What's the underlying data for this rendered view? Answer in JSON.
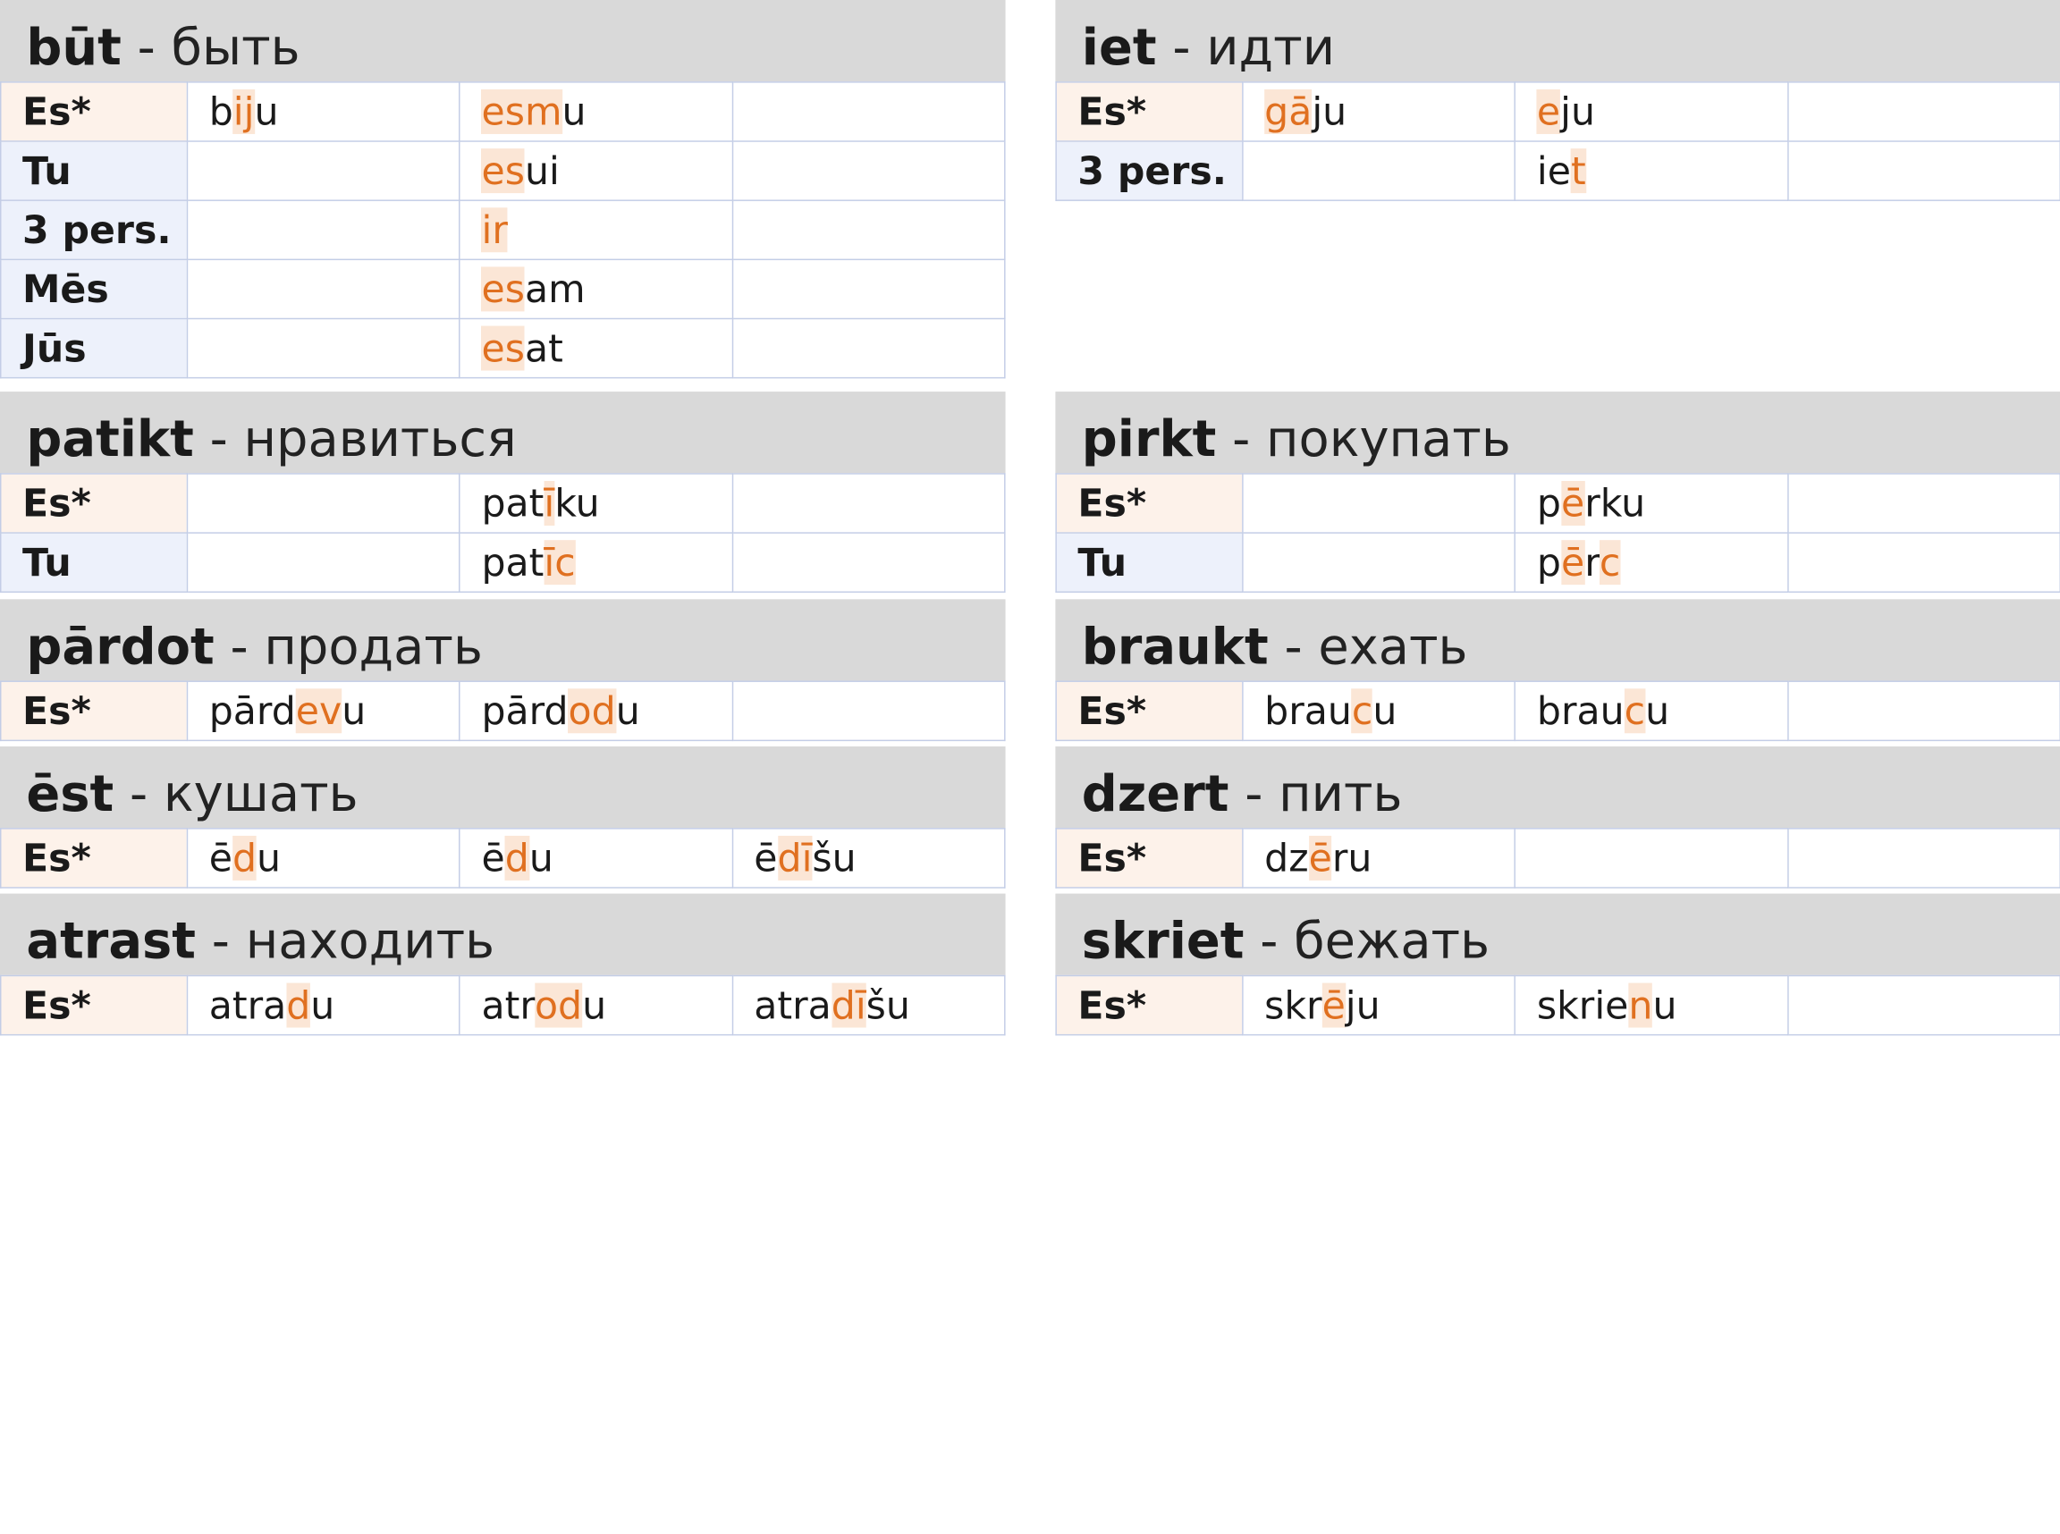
{
  "colors": {
    "header_bg": "#d9d9d9",
    "highlight_text": "#e07020",
    "highlight_bg": "#fbe6d6",
    "es_bg": "#fdf2ea",
    "pron_bg": "#edf1fb",
    "border": "#c3cde6"
  },
  "blocks": [
    {
      "verb": "būt",
      "translation": "- быть",
      "rows": [
        {
          "pronoun": "Es*",
          "forms": [
            [
              [
                "b",
                0
              ],
              [
                "ij",
                1
              ],
              [
                "u",
                0
              ]
            ],
            [
              [
                "esm",
                1
              ],
              [
                "u",
                0
              ]
            ],
            []
          ]
        },
        {
          "pronoun": "Tu",
          "forms": [
            [],
            [
              [
                "es",
                1
              ],
              [
                "ui",
                0
              ]
            ],
            []
          ]
        },
        {
          "pronoun": "3 pers.",
          "forms": [
            [],
            [
              [
                "ir",
                1
              ]
            ],
            []
          ]
        },
        {
          "pronoun": "Mēs",
          "forms": [
            [],
            [
              [
                "es",
                1
              ],
              [
                "am",
                0
              ]
            ],
            []
          ]
        },
        {
          "pronoun": "Jūs",
          "forms": [
            [],
            [
              [
                "es",
                1
              ],
              [
                "at",
                0
              ]
            ],
            []
          ]
        }
      ]
    },
    {
      "verb": "iet",
      "translation": "- идти",
      "rows": [
        {
          "pronoun": "Es*",
          "forms": [
            [
              [
                "gā",
                1
              ],
              [
                "ju",
                0
              ]
            ],
            [
              [
                "e",
                1
              ],
              [
                "ju",
                0
              ]
            ],
            []
          ]
        },
        {
          "pronoun": "3 pers.",
          "forms": [
            [],
            [
              [
                "ie",
                0
              ],
              [
                "t",
                1
              ]
            ],
            []
          ]
        }
      ]
    },
    {
      "verb": "patikt",
      "translation": "- нравиться",
      "rows": [
        {
          "pronoun": "Es*",
          "forms": [
            [],
            [
              [
                "pat",
                0
              ],
              [
                "ī",
                1
              ],
              [
                "ku",
                0
              ]
            ],
            []
          ]
        },
        {
          "pronoun": "Tu",
          "forms": [
            [],
            [
              [
                "pat",
                0
              ],
              [
                "īc",
                1
              ]
            ],
            []
          ]
        }
      ]
    },
    {
      "verb": "pirkt",
      "translation": "- покупать",
      "rows": [
        {
          "pronoun": "Es*",
          "forms": [
            [],
            [
              [
                "p",
                0
              ],
              [
                "ē",
                1
              ],
              [
                "rku",
                0
              ]
            ],
            []
          ]
        },
        {
          "pronoun": "Tu",
          "forms": [
            [],
            [
              [
                "p",
                0
              ],
              [
                "ē",
                1
              ],
              [
                "r",
                0
              ],
              [
                "c",
                1
              ]
            ],
            []
          ]
        }
      ]
    },
    {
      "verb": "pārdot",
      "translation": "- продать",
      "rows": [
        {
          "pronoun": "Es*",
          "forms": [
            [
              [
                "pārd",
                0
              ],
              [
                "ev",
                1
              ],
              [
                "u",
                0
              ]
            ],
            [
              [
                "pārd",
                0
              ],
              [
                "od",
                1
              ],
              [
                "u",
                0
              ]
            ],
            []
          ]
        }
      ]
    },
    {
      "verb": "braukt",
      "translation": "- ехать",
      "rows": [
        {
          "pronoun": "Es*",
          "forms": [
            [
              [
                "brau",
                0
              ],
              [
                "c",
                1
              ],
              [
                "u",
                0
              ]
            ],
            [
              [
                "brau",
                0
              ],
              [
                "c",
                1
              ],
              [
                "u",
                0
              ]
            ],
            []
          ]
        }
      ]
    },
    {
      "verb": "ēst",
      "translation": "- кушать",
      "rows": [
        {
          "pronoun": "Es*",
          "forms": [
            [
              [
                "ē",
                0
              ],
              [
                "d",
                1
              ],
              [
                "u",
                0
              ]
            ],
            [
              [
                "ē",
                0
              ],
              [
                "d",
                1
              ],
              [
                "u",
                0
              ]
            ],
            [
              [
                "ē",
                0
              ],
              [
                "dī",
                1
              ],
              [
                "šu",
                0
              ]
            ]
          ]
        }
      ]
    },
    {
      "verb": "dzert",
      "translation": "- пить",
      "rows": [
        {
          "pronoun": "Es*",
          "forms": [
            [
              [
                "dz",
                0
              ],
              [
                "ē",
                1
              ],
              [
                "ru",
                0
              ]
            ],
            [],
            []
          ]
        }
      ]
    },
    {
      "verb": "atrast",
      "translation": "- находить",
      "rows": [
        {
          "pronoun": "Es*",
          "forms": [
            [
              [
                "atra",
                0
              ],
              [
                "d",
                1
              ],
              [
                "u",
                0
              ]
            ],
            [
              [
                "atr",
                0
              ],
              [
                "od",
                1
              ],
              [
                "u",
                0
              ]
            ],
            [
              [
                "atra",
                0
              ],
              [
                "dī",
                1
              ],
              [
                "šu",
                0
              ]
            ]
          ]
        }
      ]
    },
    {
      "verb": "skriet",
      "translation": "- бежать",
      "rows": [
        {
          "pronoun": "Es*",
          "forms": [
            [
              [
                "skr",
                0
              ],
              [
                "ē",
                1
              ],
              [
                "ju",
                0
              ]
            ],
            [
              [
                "skrie",
                0
              ],
              [
                "n",
                1
              ],
              [
                "u",
                0
              ]
            ],
            []
          ]
        }
      ]
    }
  ]
}
